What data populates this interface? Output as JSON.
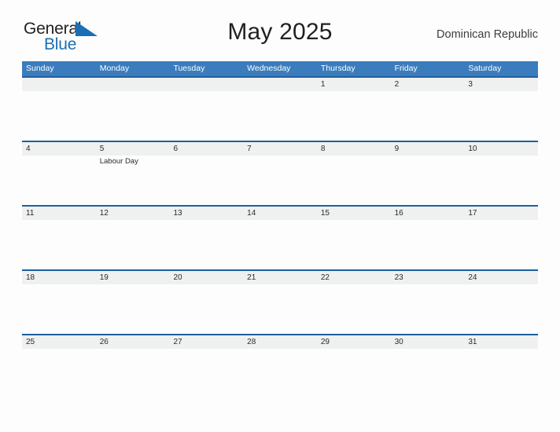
{
  "brand": {
    "word_one": "General",
    "word_two": "Blue",
    "flag_icon": "blue-triangle-flag-icon",
    "dark_color": "#231f20",
    "blue_color": "#1a6fb5"
  },
  "header": {
    "title": "May 2025",
    "country": "Dominican Republic"
  },
  "theme": {
    "header_blue": "#3b7cbd",
    "row_accent_blue": "#1f5f9e",
    "date_strip_gray": "#eff0f0",
    "page_background": "#fdfdfd",
    "text_color": "#2a2a2a"
  },
  "calendar": {
    "month": "May",
    "year": "2025",
    "weekday_headers": [
      "Sunday",
      "Monday",
      "Tuesday",
      "Wednesday",
      "Thursday",
      "Friday",
      "Saturday"
    ],
    "weeks": [
      {
        "days": [
          {
            "number": "",
            "events": []
          },
          {
            "number": "",
            "events": []
          },
          {
            "number": "",
            "events": []
          },
          {
            "number": "",
            "events": []
          },
          {
            "number": "1",
            "events": []
          },
          {
            "number": "2",
            "events": []
          },
          {
            "number": "3",
            "events": []
          }
        ]
      },
      {
        "days": [
          {
            "number": "4",
            "events": []
          },
          {
            "number": "5",
            "events": [
              "Labour Day"
            ]
          },
          {
            "number": "6",
            "events": []
          },
          {
            "number": "7",
            "events": []
          },
          {
            "number": "8",
            "events": []
          },
          {
            "number": "9",
            "events": []
          },
          {
            "number": "10",
            "events": []
          }
        ]
      },
      {
        "days": [
          {
            "number": "11",
            "events": []
          },
          {
            "number": "12",
            "events": []
          },
          {
            "number": "13",
            "events": []
          },
          {
            "number": "14",
            "events": []
          },
          {
            "number": "15",
            "events": []
          },
          {
            "number": "16",
            "events": []
          },
          {
            "number": "17",
            "events": []
          }
        ]
      },
      {
        "days": [
          {
            "number": "18",
            "events": []
          },
          {
            "number": "19",
            "events": []
          },
          {
            "number": "20",
            "events": []
          },
          {
            "number": "21",
            "events": []
          },
          {
            "number": "22",
            "events": []
          },
          {
            "number": "23",
            "events": []
          },
          {
            "number": "24",
            "events": []
          }
        ]
      },
      {
        "days": [
          {
            "number": "25",
            "events": []
          },
          {
            "number": "26",
            "events": []
          },
          {
            "number": "27",
            "events": []
          },
          {
            "number": "28",
            "events": []
          },
          {
            "number": "29",
            "events": []
          },
          {
            "number": "30",
            "events": []
          },
          {
            "number": "31",
            "events": []
          }
        ]
      }
    ]
  }
}
